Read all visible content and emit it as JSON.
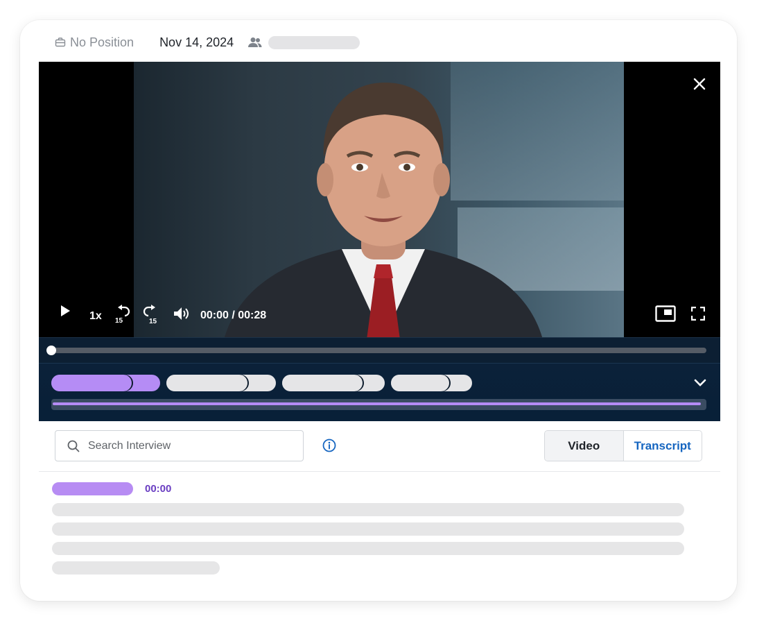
{
  "header": {
    "position": "No Position",
    "date": "Nov 14, 2024"
  },
  "player": {
    "speed": "1x",
    "rewind_seconds": "15",
    "forward_seconds": "15",
    "time": "00:00 / 00:28",
    "progress": 0
  },
  "segments": {
    "colors": {
      "active": "#b58cf5",
      "inactive": "#e5e5e7"
    }
  },
  "search": {
    "placeholder": "Search Interview"
  },
  "view_toggle": {
    "video": "Video",
    "transcript": "Transcript"
  },
  "transcript": {
    "first_timestamp": "00:00"
  }
}
